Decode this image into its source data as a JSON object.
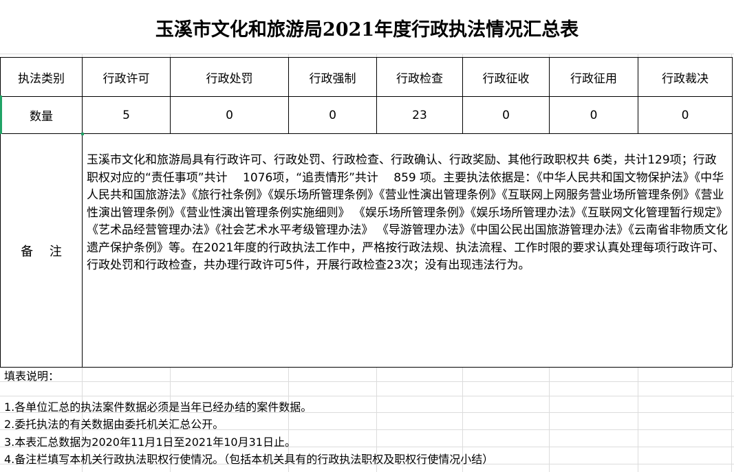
{
  "title": "玉溪市文化和旅游局2021年度行政执法情况汇总表",
  "table": {
    "header_label": "执法类别",
    "categories": [
      "行政许可",
      "行政处罚",
      "行政强制",
      "行政检查",
      "行政征收",
      "行政征用",
      "行政裁决"
    ],
    "count_label": "数量",
    "counts": [
      "5",
      "0",
      "0",
      "23",
      "0",
      "0",
      "0"
    ],
    "note_label": "备　 注",
    "note_text": "玉溪市文化和旅游局具有行政许可、行政处罚、行政检查、行政确认、行政奖励、其他行政职权共 6类，共计129项；行政职权对应的“责任事项”共计　 1076项，“追责情形”共计　 859 项。主要执法依据是：《中华人民共和国文物保护法》《中华人民共和国旅游法》《旅行社条例》《娱乐场所管理条例》《营业性演出管理条例》《互联网上网服务营业场所管理条例》《营业性演出管理条例》《营业性演出管理条例实施细则》 《娱乐场所管理条例》《娱乐场所管理办法》《互联网文化管理暂行规定》《艺术品经营管理办法》《社会艺术水平考级管理办法》 《导游管理办法》《中国公民出国旅游管理办法》《云南省非物质文化遗产保护条例》等。在2021年度的行政执法工作中，严格按行政法规、执法流程、工作时限的要求认真处理每项行政许可、行政处罚和行政检查，共办理行政许可5件，开展行政检查23次；没有出现违法行为。"
  },
  "instructions": {
    "heading": "填表说明：",
    "items": [
      "1.各单位汇总的执法案件数据必须是当年已经办结的案件数据。",
      "2.委托执法的有关数据由委托机关汇总公开。",
      "3.本表汇总数据为2020年11月1日至2021年10月31日止。",
      "4.备注栏填写本机关行政执法职权行使情况。（包括本机关具有的行政执法职权及职权行使情况小结）"
    ]
  },
  "colors": {
    "selection": "#21a366",
    "gridline": "#dcdcdc",
    "border": "#000000"
  }
}
